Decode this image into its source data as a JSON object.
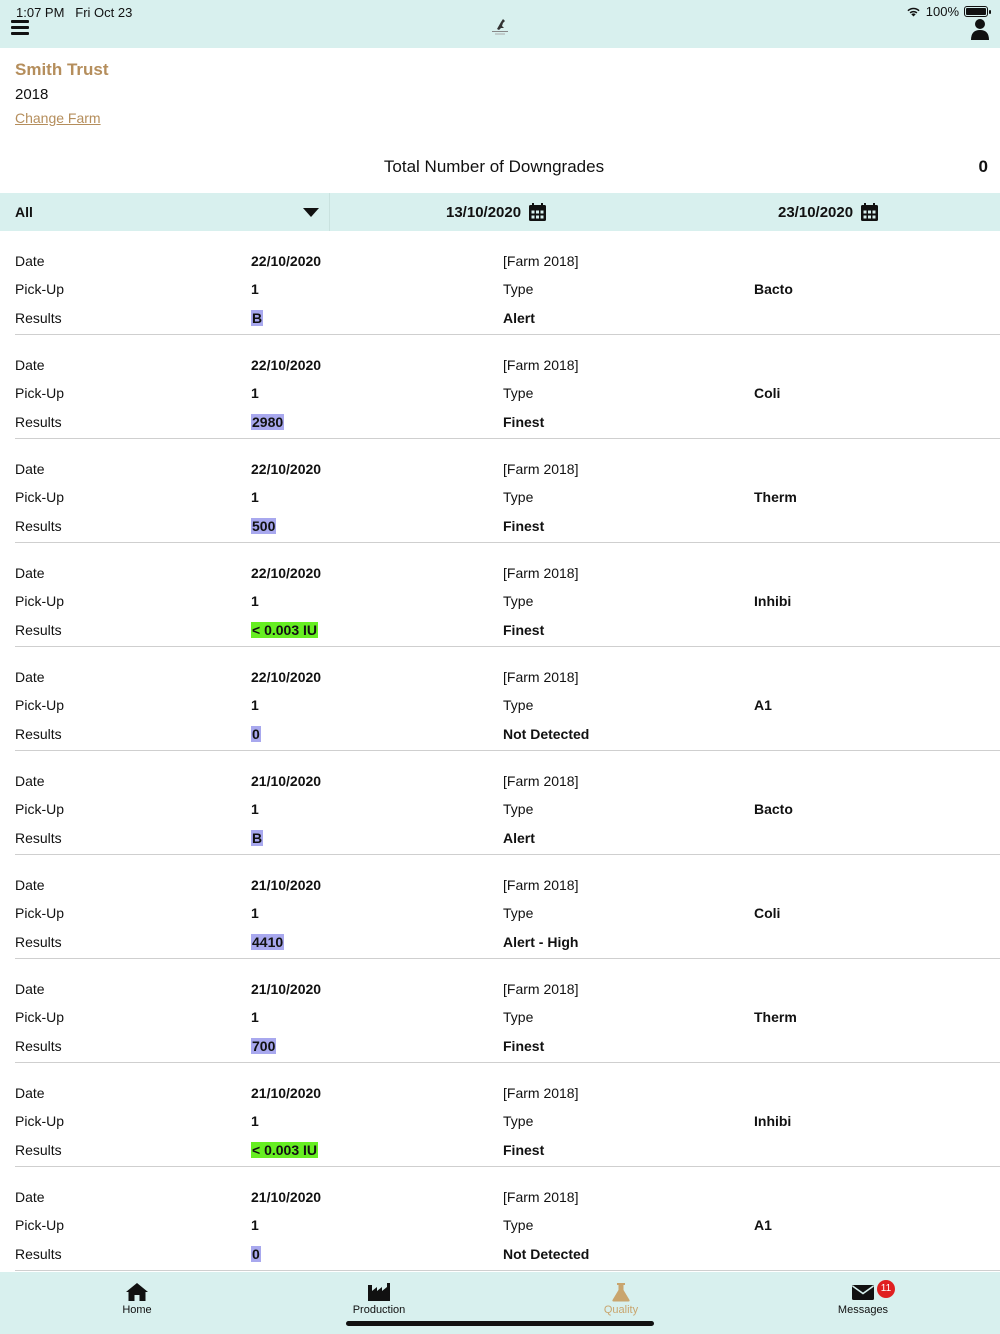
{
  "status": {
    "time": "1:07 PM",
    "date": "Fri Oct 23",
    "battery": "100%"
  },
  "header": {
    "farm_name": "Smith Trust",
    "year": "2018",
    "change_farm": "Change Farm"
  },
  "summary": {
    "label": "Total Number of Downgrades",
    "value": "0"
  },
  "filters": {
    "selected": "All",
    "from_date": "13/10/2020",
    "to_date": "23/10/2020"
  },
  "labels": {
    "date": "Date",
    "pickup": "Pick-Up",
    "results": "Results",
    "type": "Type"
  },
  "records": [
    {
      "date": "22/10/2020",
      "pickup": "1",
      "farm": "[Farm 2018]",
      "type": "Bacto",
      "result": "B",
      "grade": "Alert"
    },
    {
      "date": "22/10/2020",
      "pickup": "1",
      "farm": "[Farm 2018]",
      "type": "Coli",
      "result": "2980",
      "grade": "Finest"
    },
    {
      "date": "22/10/2020",
      "pickup": "1",
      "farm": "[Farm 2018]",
      "type": "Therm",
      "result": "500",
      "grade": "Finest"
    },
    {
      "date": "22/10/2020",
      "pickup": "1",
      "farm": "[Farm 2018]",
      "type": "Inhibi",
      "result": "< 0.003 IU",
      "grade": "Finest"
    },
    {
      "date": "22/10/2020",
      "pickup": "1",
      "farm": "[Farm 2018]",
      "type": "A1",
      "result": "0",
      "grade": "Not Detected"
    },
    {
      "date": "21/10/2020",
      "pickup": "1",
      "farm": "[Farm 2018]",
      "type": "Bacto",
      "result": "B",
      "grade": "Alert"
    },
    {
      "date": "21/10/2020",
      "pickup": "1",
      "farm": "[Farm 2018]",
      "type": "Coli",
      "result": "4410",
      "grade": "Alert - High"
    },
    {
      "date": "21/10/2020",
      "pickup": "1",
      "farm": "[Farm 2018]",
      "type": "Therm",
      "result": "700",
      "grade": "Finest"
    },
    {
      "date": "21/10/2020",
      "pickup": "1",
      "farm": "[Farm 2018]",
      "type": "Inhibi",
      "result": "< 0.003 IU",
      "grade": "Finest"
    },
    {
      "date": "21/10/2020",
      "pickup": "1",
      "farm": "[Farm 2018]",
      "type": "A1",
      "result": "0",
      "grade": "Not Detected"
    }
  ],
  "tabs": {
    "home": "Home",
    "production": "Production",
    "quality": "Quality",
    "messages": "Messages",
    "messages_badge": "11"
  },
  "colors": {
    "bar_background": "#d8f0ee",
    "accent": "#b58e5c",
    "active_tab": "#c9a56e",
    "result_highlight_blue": "#a8a8ee",
    "result_highlight_green": "#66ee22",
    "badge": "#e02020"
  }
}
